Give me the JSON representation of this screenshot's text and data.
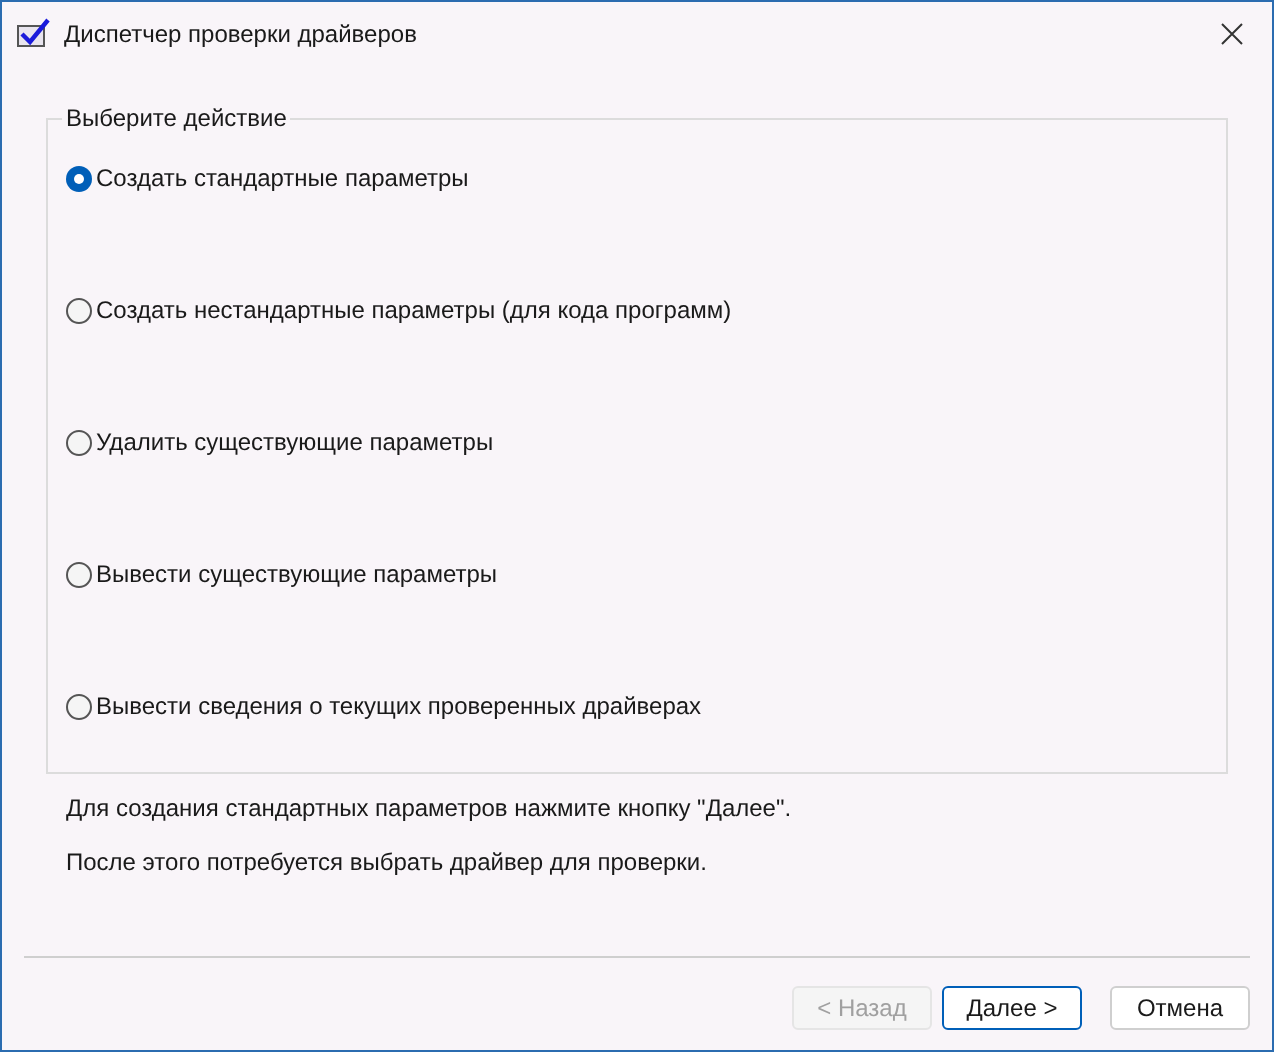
{
  "window": {
    "title": "Диспетчер проверки драйверов"
  },
  "group": {
    "legend": "Выберите действие",
    "options": [
      {
        "label": "Создать стандартные параметры",
        "selected": true
      },
      {
        "label": "Создать нестандартные параметры (для кода программ)",
        "selected": false
      },
      {
        "label": "Удалить существующие параметры",
        "selected": false
      },
      {
        "label": "Вывести существующие параметры",
        "selected": false
      },
      {
        "label": "Вывести сведения о текущих проверенных драйверах",
        "selected": false
      }
    ]
  },
  "notes": [
    "Для создания стандартных параметров нажмите кнопку \"Далее\".",
    "После этого потребуется выбрать драйвер для проверки."
  ],
  "buttons": [
    {
      "label": "< Назад",
      "disabled": true,
      "default": false
    },
    {
      "label": "Далее >",
      "disabled": false,
      "default": true
    },
    {
      "label": "Отмена",
      "disabled": false,
      "default": false
    }
  ]
}
